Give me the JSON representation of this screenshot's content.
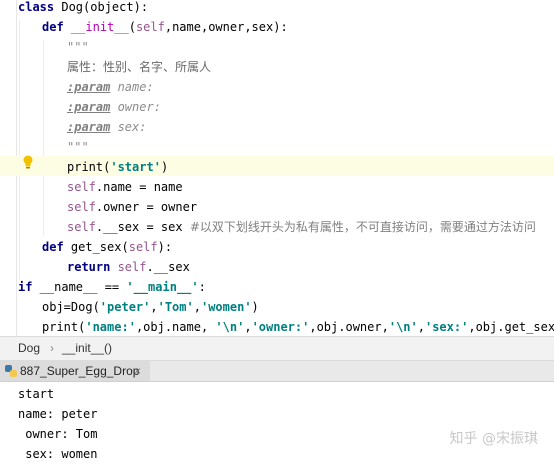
{
  "code": {
    "l1_kw": "class",
    "l1_rest": " Dog(object):",
    "l2_kw": "def",
    "l2_magic": "__init__",
    "l2_open": "(",
    "l2_self": "self",
    "l2_rest": ",name,owner,sex):",
    "l3_doc": "\"\"\"",
    "l4_text": "属性：性别、名字、所属人",
    "l5_tag": ":param",
    "l5_arg": " name:",
    "l6_tag": ":param",
    "l6_arg": " owner:",
    "l7_tag": ":param",
    "l7_arg": " sex:",
    "l8_doc": "\"\"\"",
    "l9_fn": "print(",
    "l9_str": "'start'",
    "l9_close": ")",
    "l10_self": "self",
    "l10_rest": ".name = name",
    "l11_self": "self",
    "l11_rest": ".owner = owner",
    "l12_self": "self",
    "l12_rest": ".__sex = sex ",
    "l12_comment": "#以双下划线开头为私有属性，不可直接访问，需要通过方法访问",
    "l13_kw": "def",
    "l13_rest": " get_sex(",
    "l13_self": "self",
    "l13_close": "):",
    "l14_kw": "return",
    "l14_self": " self",
    "l14_rest": ".__sex",
    "l15_kw": "if",
    "l15_rest": " __name__ == ",
    "l15_str": "'__main__'",
    "l15_close": ":",
    "l16_pre": "obj=Dog(",
    "l16_s1": "'peter'",
    "l16_c1": ",",
    "l16_s2": "'Tom'",
    "l16_c2": ",",
    "l16_s3": "'women'",
    "l16_close": ")",
    "l17_pre": "print(",
    "l17_s1": "'name:'",
    "l17_m1": ",obj.name, ",
    "l17_s2": "'\\n'",
    "l17_c2": ",",
    "l17_s3": "'owner:'",
    "l17_m3": ",obj.owner,",
    "l17_s4": "'\\n'",
    "l17_c4": ",",
    "l17_s5": "'sex:'",
    "l17_m5": ",obj.get_sex())"
  },
  "breadcrumb": {
    "class_name": "Dog",
    "separator": "›",
    "method_name": "__init__()"
  },
  "run_tab": {
    "label": "887_Super_Egg_Drop",
    "close": "×"
  },
  "console": {
    "lines": [
      "start",
      "name: peter",
      " owner: Tom",
      " sex: women"
    ]
  },
  "watermark": "知乎 @宋振琪",
  "colors": {
    "keyword": "#000080",
    "string": "#008080",
    "self": "#94558d",
    "magic": "#b200b2",
    "doc": "#8c8c8c",
    "highlight": "#fdfde3",
    "bulb": "#f2c200"
  }
}
